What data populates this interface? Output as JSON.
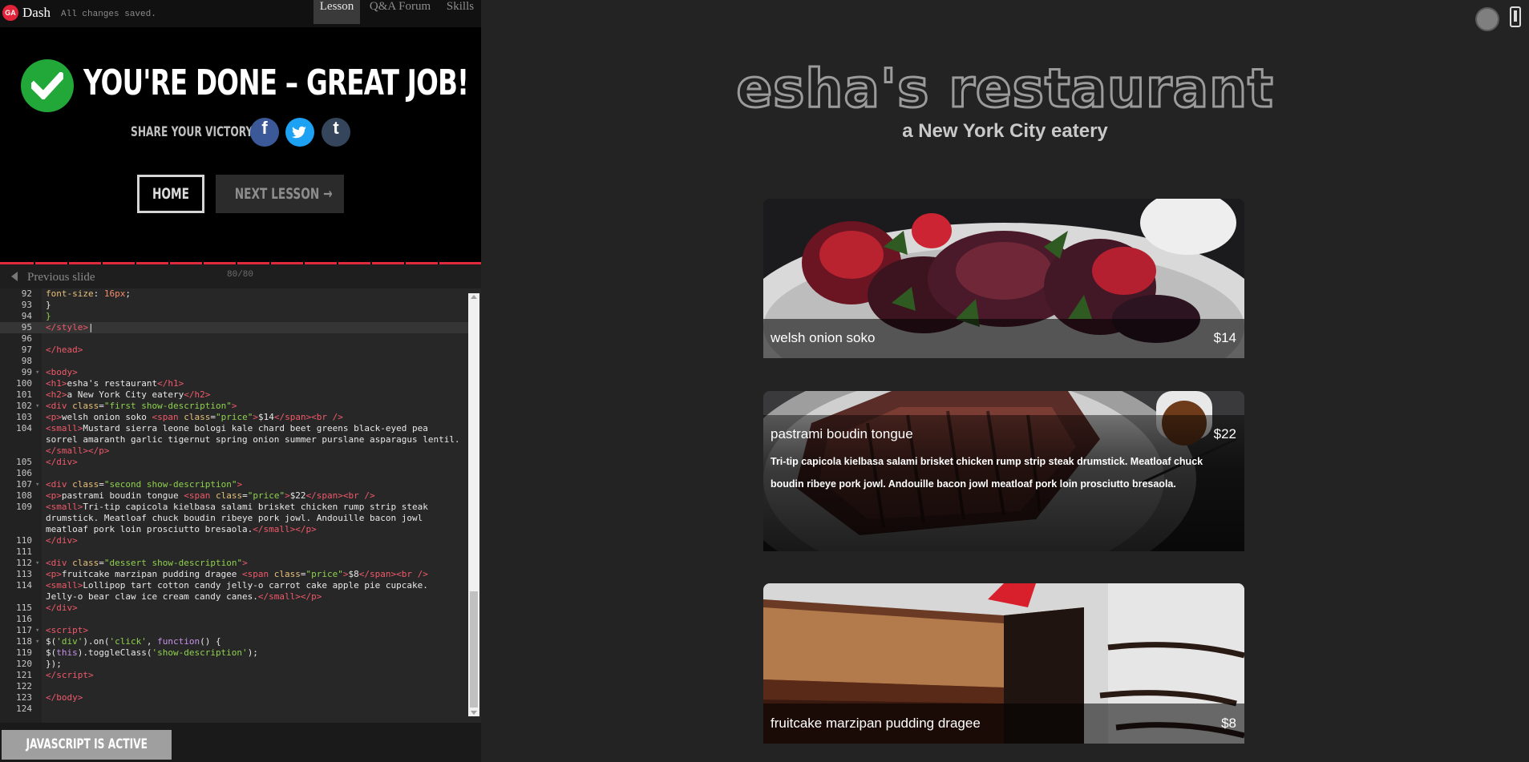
{
  "topbar": {
    "logo_text": "GA",
    "app_name": "Dash",
    "save_status": "All changes saved.",
    "tabs": [
      "Lesson",
      "Q&A Forum",
      "Skills"
    ],
    "active_tab": "Lesson"
  },
  "completion": {
    "title": "YOU'RE DONE – GREAT JOB!",
    "share_label": "SHARE YOUR VICTORY:",
    "social": [
      "facebook-icon",
      "twitter-icon",
      "tumblr-icon"
    ],
    "social_glyphs": [
      "f",
      "t",
      "t"
    ],
    "home_label": "HOME",
    "next_label": "NEXT LESSON →"
  },
  "slides": {
    "prev_label": "Previous slide",
    "counter": "80/80",
    "progress": 1.0
  },
  "editor": {
    "lines": [
      {
        "no": "92",
        "fold": "",
        "html": "    <span class=\"p\">font-size</span>: <span class=\"n\">16px</span>;"
      },
      {
        "no": "93",
        "fold": "",
        "html": "    }"
      },
      {
        "no": "94",
        "fold": "",
        "html": "<span class=\"a\">}</span>"
      },
      {
        "no": "95",
        "fold": "",
        "html": "<span class=\"t\">&lt;/style&gt;</span>|",
        "active": true
      },
      {
        "no": "96",
        "fold": "",
        "html": ""
      },
      {
        "no": "97",
        "fold": "",
        "html": "<span class=\"t\">&lt;/head&gt;</span>"
      },
      {
        "no": "98",
        "fold": "",
        "html": ""
      },
      {
        "no": "99",
        "fold": "▾",
        "html": "<span class=\"t\">&lt;body&gt;</span>"
      },
      {
        "no": "100",
        "fold": "",
        "html": "<span class=\"t\">&lt;h1&gt;</span>esha's restaurant<span class=\"t\">&lt;/h1&gt;</span>"
      },
      {
        "no": "101",
        "fold": "",
        "html": "<span class=\"t\">&lt;h2&gt;</span>a New York City eatery<span class=\"t\">&lt;/h2&gt;</span>"
      },
      {
        "no": "102",
        "fold": "▾",
        "html": "<span class=\"t\">&lt;div</span> <span class=\"p\">class</span>=<span class=\"s\">\"first show-description\"</span><span class=\"t\">&gt;</span>"
      },
      {
        "no": "103",
        "fold": "",
        "html": "  <span class=\"t\">&lt;p&gt;</span>welsh onion soko <span class=\"t\">&lt;span</span> <span class=\"p\">class</span>=<span class=\"s\">\"price\"</span><span class=\"t\">&gt;</span>$14<span class=\"t\">&lt;/span&gt;&lt;br /&gt;</span>"
      },
      {
        "no": "104",
        "fold": "",
        "html": "  <span class=\"t\">&lt;small&gt;</span>Mustard sierra leone bologi kale chard beet greens black-eyed pea"
      },
      {
        "no": "",
        "fold": "",
        "html": "sorrel amaranth garlic tigernut spring onion summer purslane asparagus lentil.",
        "wrap": true
      },
      {
        "no": "",
        "fold": "",
        "html": "<span class=\"t\">&lt;/small&gt;&lt;/p&gt;</span>",
        "wrap": true
      },
      {
        "no": "105",
        "fold": "",
        "html": "<span class=\"t\">&lt;/div&gt;</span>"
      },
      {
        "no": "106",
        "fold": "",
        "html": ""
      },
      {
        "no": "107",
        "fold": "▾",
        "html": "<span class=\"t\">&lt;div</span> <span class=\"p\">class</span>=<span class=\"s\">\"second show-description\"</span><span class=\"t\">&gt;</span>"
      },
      {
        "no": "108",
        "fold": "",
        "html": "  <span class=\"t\">&lt;p&gt;</span>pastrami boudin tongue <span class=\"t\">&lt;span</span> <span class=\"p\">class</span>=<span class=\"s\">\"price\"</span><span class=\"t\">&gt;</span>$22<span class=\"t\">&lt;/span&gt;&lt;br /&gt;</span>"
      },
      {
        "no": "109",
        "fold": "",
        "html": "  <span class=\"t\">&lt;small&gt;</span>Tri-tip capicola kielbasa salami brisket chicken rump strip steak"
      },
      {
        "no": "",
        "fold": "",
        "html": "drumstick. Meatloaf chuck boudin ribeye pork jowl. Andouille bacon jowl",
        "wrap": true
      },
      {
        "no": "",
        "fold": "",
        "html": "meatloaf pork loin prosciutto bresaola.<span class=\"t\">&lt;/small&gt;&lt;/p&gt;</span>",
        "wrap": true
      },
      {
        "no": "110",
        "fold": "",
        "html": "<span class=\"t\">&lt;/div&gt;</span>"
      },
      {
        "no": "111",
        "fold": "",
        "html": ""
      },
      {
        "no": "112",
        "fold": "▾",
        "html": "<span class=\"t\">&lt;div</span> <span class=\"p\">class</span>=<span class=\"s\">\"dessert show-description\"</span><span class=\"t\">&gt;</span>"
      },
      {
        "no": "113",
        "fold": "",
        "html": "  <span class=\"t\">&lt;p&gt;</span>fruitcake marzipan pudding dragee <span class=\"t\">&lt;span</span> <span class=\"p\">class</span>=<span class=\"s\">\"price\"</span><span class=\"t\">&gt;</span>$8<span class=\"t\">&lt;/span&gt;&lt;br /&gt;</span>"
      },
      {
        "no": "114",
        "fold": "",
        "html": "  <span class=\"t\">&lt;small&gt;</span>Lollipop tart cotton candy jelly-o carrot cake apple pie cupcake."
      },
      {
        "no": "",
        "fold": "",
        "html": "Jelly-o bear claw ice cream candy canes.<span class=\"t\">&lt;/small&gt;&lt;/p&gt;</span>",
        "wrap": true
      },
      {
        "no": "115",
        "fold": "",
        "html": "<span class=\"t\">&lt;/div&gt;</span>"
      },
      {
        "no": "116",
        "fold": "",
        "html": ""
      },
      {
        "no": "117",
        "fold": "▾",
        "html": "<span class=\"t\">&lt;script&gt;</span>"
      },
      {
        "no": "118",
        "fold": "▾",
        "html": "  $(<span class=\"s\">'div'</span>).on(<span class=\"s\">'click'</span>, <span class=\"k\">function</span>() {"
      },
      {
        "no": "119",
        "fold": "",
        "html": "    $(<span class=\"k\">this</span>).toggleClass(<span class=\"s\">'show-description'</span>);"
      },
      {
        "no": "120",
        "fold": "",
        "html": "  });"
      },
      {
        "no": "121",
        "fold": "",
        "html": "<span class=\"t\">&lt;/script&gt;</span>"
      },
      {
        "no": "122",
        "fold": "",
        "html": ""
      },
      {
        "no": "123",
        "fold": "",
        "html": "<span class=\"t\">&lt;/body&gt;</span>"
      },
      {
        "no": "124",
        "fold": "",
        "html": ""
      }
    ]
  },
  "status": {
    "js_label": "JAVASCRIPT IS ACTIVE"
  },
  "preview": {
    "title": "esha's restaurant",
    "subtitle": "a New York City eatery",
    "items": [
      {
        "name": "welsh onion soko",
        "price": "$14",
        "description": ""
      },
      {
        "name": "pastrami boudin tongue",
        "price": "$22",
        "description": "Tri-tip capicola kielbasa salami brisket chicken rump strip steak drumstick. Meatloaf chuck boudin ribeye pork jowl. Andouille bacon jowl meatloaf pork loin prosciutto bresaola."
      },
      {
        "name": "fruitcake marzipan pudding dragee",
        "price": "$8",
        "description": ""
      }
    ]
  }
}
